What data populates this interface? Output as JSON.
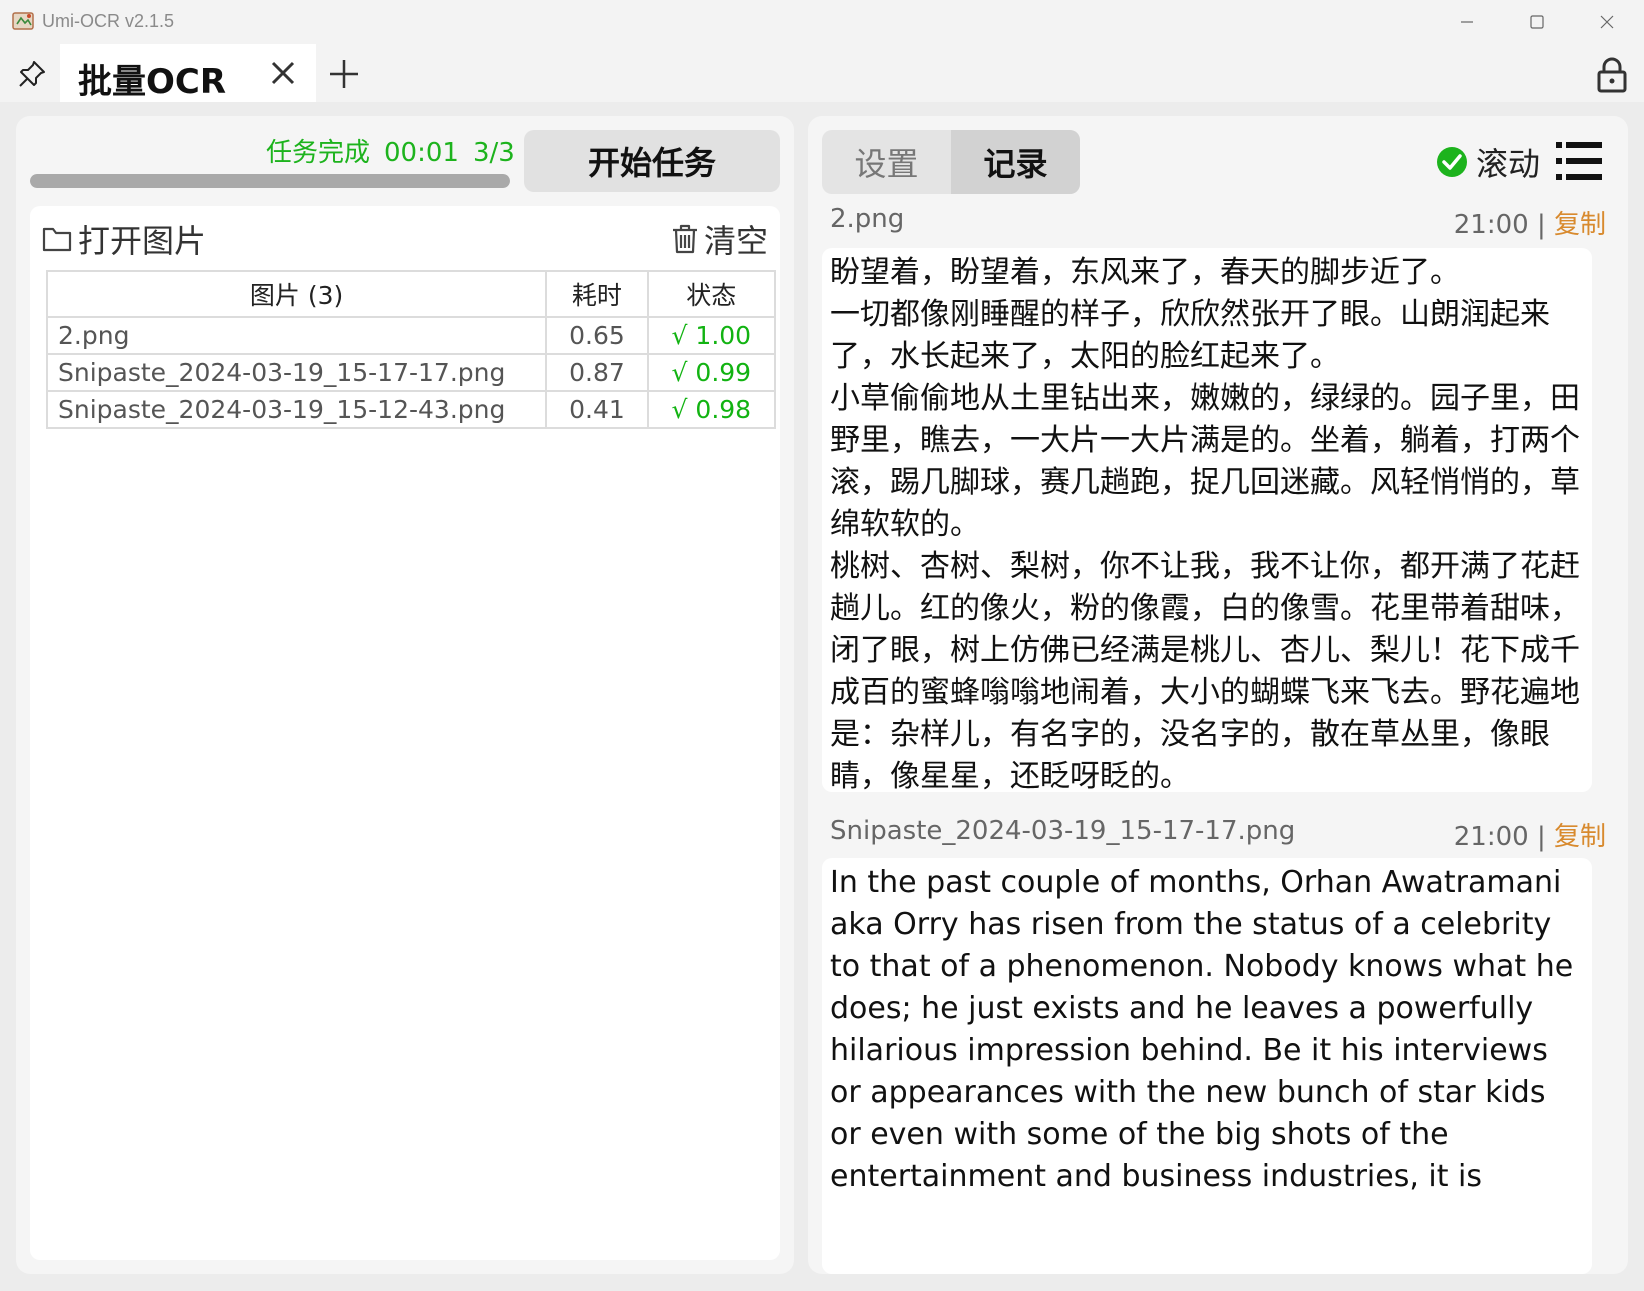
{
  "window": {
    "title": "Umi-OCR v2.1.5",
    "icon": "app-icon"
  },
  "tabs": [
    {
      "label": "批量OCR",
      "active": true
    }
  ],
  "toolbar_icons": [
    "pin-icon",
    "close-icon",
    "plus-icon",
    "lock-icon"
  ],
  "task": {
    "status": "任务完成",
    "elapsed": "00:01",
    "count": "3/3",
    "progress_fraction": 1.0,
    "start_button": "开始任务"
  },
  "files": {
    "open_label": "打开图片",
    "clear_label": "清空",
    "headers": {
      "image": "图片 (3)",
      "time": "耗时",
      "state": "状态"
    },
    "rows": [
      {
        "name": "2.png",
        "time": "0.65",
        "state": "√ 1.00"
      },
      {
        "name": "Snipaste_2024-03-19_15-17-17.png",
        "time": "0.87",
        "state": "√ 0.99"
      },
      {
        "name": "Snipaste_2024-03-19_15-12-43.png",
        "time": "0.41",
        "state": "√ 0.98"
      }
    ]
  },
  "right": {
    "tabs": {
      "settings": "设置",
      "records": "记录"
    },
    "active_tab": "records",
    "scroll_label": "滚动",
    "scroll_checked": true,
    "records": [
      {
        "name": "2.png",
        "time": "21:00",
        "separator": "|",
        "copy": "复制",
        "text": "盼望着，盼望着，东风来了，春天的脚步近了。\n一切都像刚睡醒的样子，欣欣然张开了眼。山朗润起来了，水长起来了，太阳的脸红起来了。\n小草偷偷地从土里钻出来，嫩嫩的，绿绿的。园子里，田野里，瞧去，一大片一大片满是的。坐着，躺着，打两个滚，踢几脚球，赛几趟跑，捉几回迷藏。风轻悄悄的，草绵软软的。\n桃树、杏树、梨树，你不让我，我不让你，都开满了花赶趟儿。红的像火，粉的像霞，白的像雪。花里带着甜味，闭了眼，树上仿佛已经满是桃儿、杏儿、梨儿！花下成千成百的蜜蜂嗡嗡地闹着，大小的蝴蝶飞来飞去。野花遍地是：杂样儿，有名字的，没名字的，散在草丛里，像眼睛，像星星，还眨呀眨的。"
      },
      {
        "name": "Snipaste_2024-03-19_15-17-17.png",
        "time": "21:00",
        "separator": "|",
        "copy": "复制",
        "text": "In the past couple of months, Orhan Awatramani aka Orry has risen from the status of a celebrity to that of a phenomenon. Nobody knows what he does; he just exists and he leaves a powerfully hilarious impression behind. Be it his interviews or appearances with the new bunch of star kids or even with some of the big shots of the entertainment and business industries, it is"
      }
    ]
  },
  "colors": {
    "status_green": "#1db31d",
    "check_green": "#12b312",
    "copy_orange": "#d88a2e"
  }
}
